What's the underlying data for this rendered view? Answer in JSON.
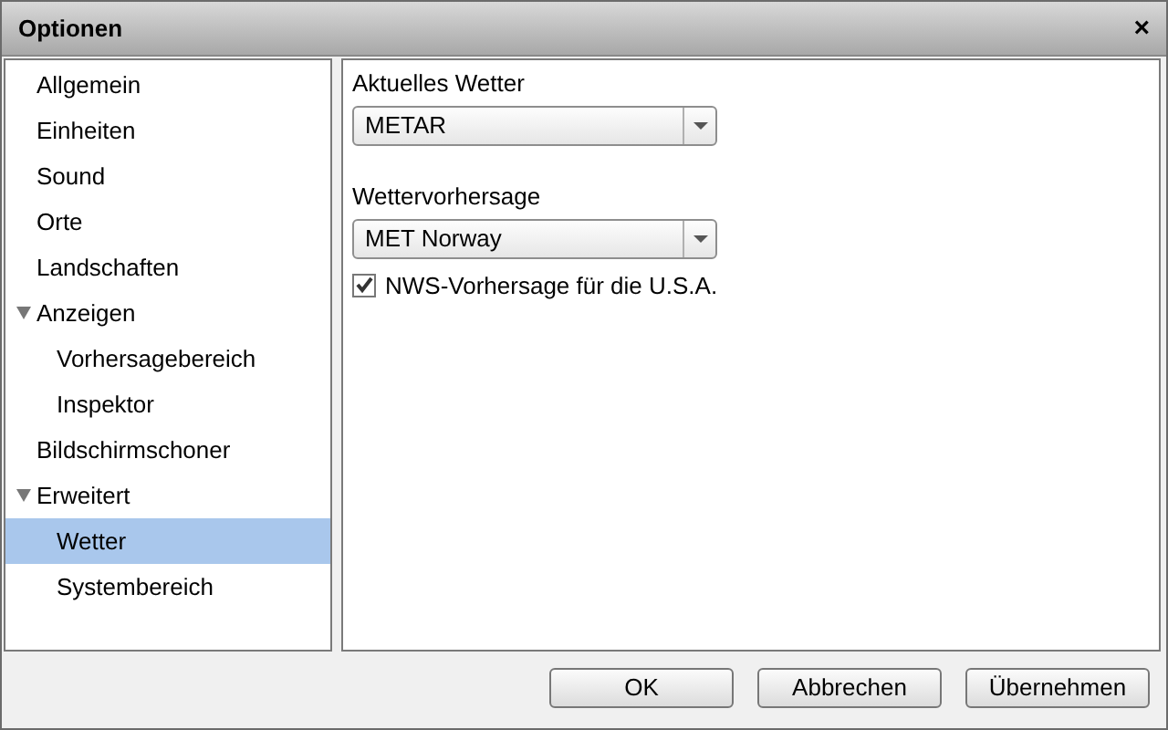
{
  "window": {
    "title": "Optionen",
    "close": "×"
  },
  "sidebar": {
    "items": [
      {
        "label": "Allgemein",
        "selected": false
      },
      {
        "label": "Einheiten",
        "selected": false
      },
      {
        "label": "Sound",
        "selected": false
      },
      {
        "label": "Orte",
        "selected": false
      },
      {
        "label": "Landschaften",
        "selected": false
      },
      {
        "label": "Anzeigen",
        "selected": false,
        "expanded": true,
        "children": [
          {
            "label": "Vorhersagebereich",
            "selected": false
          },
          {
            "label": "Inspektor",
            "selected": false
          }
        ]
      },
      {
        "label": "Bildschirmschoner",
        "selected": false
      },
      {
        "label": "Erweitert",
        "selected": false,
        "expanded": true,
        "children": [
          {
            "label": "Wetter",
            "selected": true
          },
          {
            "label": "Systembereich",
            "selected": false
          }
        ]
      }
    ]
  },
  "settings": [
    {
      "kind": "dropdown",
      "label": "Aktuelles Wetter",
      "value": "METAR"
    },
    {
      "kind": "dropdown",
      "label": "Wettervorhersage",
      "value": "MET Norway"
    },
    {
      "kind": "checkbox",
      "label": "NWS-Vorhersage für die U.S.A.",
      "checked": true
    }
  ],
  "buttons": [
    "OK",
    "Abbrechen",
    "Übernehmen"
  ]
}
